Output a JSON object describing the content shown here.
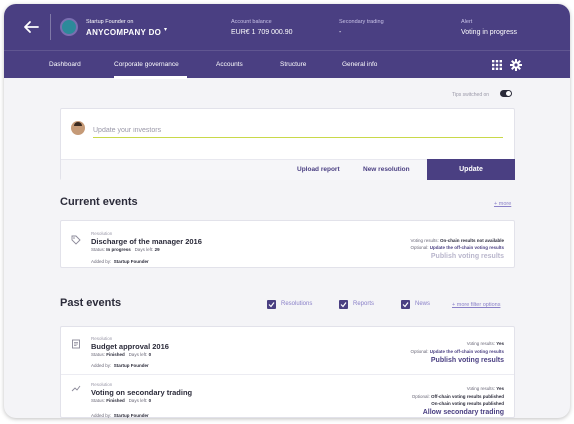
{
  "header": {
    "account_caption": "Startup Founder on",
    "company_name": "ANYCOMPANY DO",
    "columns": [
      {
        "label": "Account balance",
        "value": "EUR€ 1 709 000.90"
      },
      {
        "label": "Secondary trading",
        "value": "-"
      },
      {
        "label": "Alert",
        "value": "Voting  in progress"
      }
    ]
  },
  "nav": {
    "tabs": [
      "Dashboard",
      "Corporate governance",
      "Accounts",
      "Structure",
      "General info"
    ],
    "active_tab": "Corporate governance"
  },
  "tips": {
    "label": "Tips switched on",
    "enabled": true
  },
  "update_box": {
    "placeholder": "Update your investors",
    "upload_label": "Upload report",
    "new_resolution_label": "New resolution",
    "update_label": "Update"
  },
  "current_events": {
    "title": "Current events",
    "more_label": "+ more",
    "items": [
      {
        "type": "Resolution",
        "title": "Discharge of the manager 2016",
        "status_label": "Status:",
        "status": "In progress",
        "days_label": "Days left:",
        "days": "29",
        "added_label": "Added by:",
        "added_by": "Startup Founder",
        "voting_label": "Voting results:",
        "voting_value": "On-chain results not available",
        "optional_label": "Optional:",
        "optional_value": "Update the off-chain voting results",
        "action": "Publish voting results",
        "action_color": "#b9b6cc"
      }
    ]
  },
  "past_events": {
    "title": "Past events",
    "filters": [
      {
        "label": "Resolutions",
        "checked": true
      },
      {
        "label": "Reports",
        "checked": true
      },
      {
        "label": "News",
        "checked": true
      }
    ],
    "more_filters_label": "+ more filter options",
    "items": [
      {
        "type": "Resolution",
        "title": "Budget approval 2016",
        "status_label": "Status:",
        "status": "Finished",
        "days_label": "Days left:",
        "days": "0",
        "added_label": "Added by:",
        "added_by": "Startup Founder",
        "voting_label": "Voting results:",
        "voting_value": "Yes",
        "optional_label": "Optional:",
        "optional_value": "Update the off-chain voting results",
        "action": "Publish voting results",
        "action_color": "#4a3f82"
      },
      {
        "type": "Resolution",
        "title": "Voting on secondary trading",
        "status_label": "Status:",
        "status": "Finished",
        "days_label": "Days left:",
        "days": "0",
        "added_label": "Added by:",
        "added_by": "Startup Founder",
        "voting_label": "Voting results:",
        "voting_value": "Yes",
        "optional_label": "Optional:",
        "optional_value": "Off-chain voting results published",
        "extra_value": "On-chain voting results published",
        "action": "Allow secondary trading",
        "action_color": "#4a3f82"
      }
    ]
  },
  "colors": {
    "brand": "#4a3f82",
    "accent_underline": "#c9d94a"
  }
}
